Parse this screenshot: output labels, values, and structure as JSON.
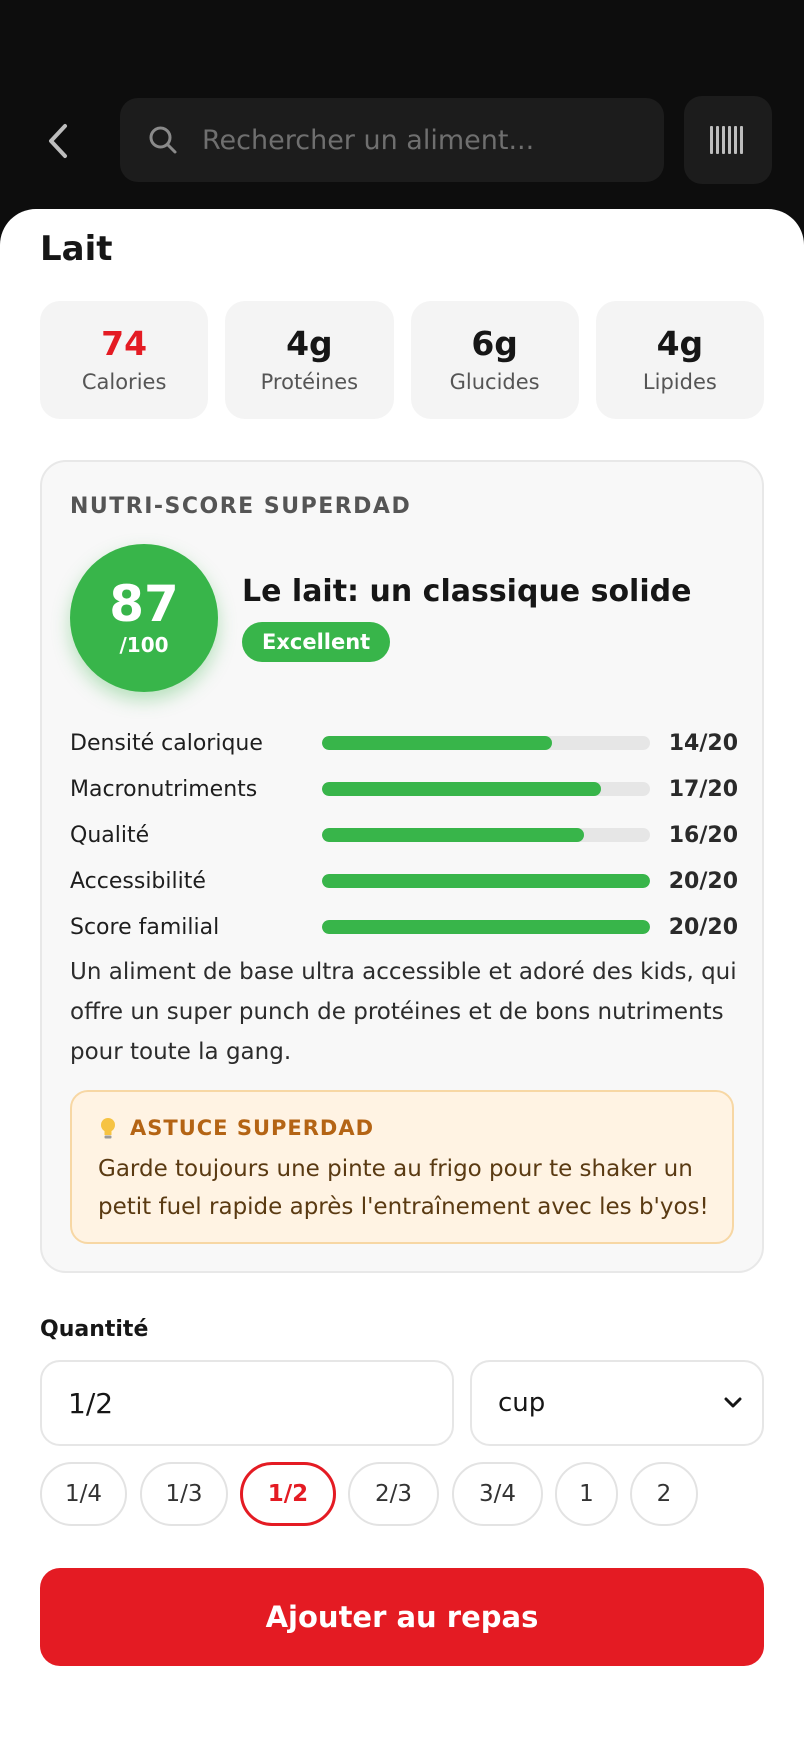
{
  "header": {
    "search_placeholder": "Rechercher un aliment..."
  },
  "food": {
    "name": "Lait"
  },
  "macros": [
    {
      "value": "74",
      "label": "Calories"
    },
    {
      "value": "4g",
      "label": "Protéines"
    },
    {
      "value": "6g",
      "label": "Glucides"
    },
    {
      "value": "4g",
      "label": "Lipides"
    }
  ],
  "score": {
    "heading": "NUTRI-SCORE SUPERDAD",
    "value": "87",
    "denominator": "/100",
    "title": "Le lait: un classique solide",
    "badge": "Excellent",
    "criteria": [
      {
        "name": "Densité calorique",
        "points": "14/20",
        "fraction": 0.7
      },
      {
        "name": "Macronutriments",
        "points": "17/20",
        "fraction": 0.85
      },
      {
        "name": "Qualité",
        "points": "16/20",
        "fraction": 0.8
      },
      {
        "name": "Accessibilité",
        "points": "20/20",
        "fraction": 1.0
      },
      {
        "name": "Score familial",
        "points": "20/20",
        "fraction": 1.0
      }
    ],
    "description": "Un aliment de base ultra accessible et adoré des kids, qui offre un super punch de protéines et de bons nutriments pour toute la gang.",
    "tip_heading": "ASTUCE SUPERDAD",
    "tip_body": "Garde toujours une pinte au frigo pour te shaker un petit fuel rapide après l'entraînement avec les b'yos!"
  },
  "quantity": {
    "label": "Quantité",
    "value": "1/2",
    "unit": "cup",
    "presets": [
      "1/4",
      "1/3",
      "1/2",
      "2/3",
      "3/4",
      "1",
      "2"
    ],
    "selected": "1/2"
  },
  "actions": {
    "add_label": "Ajouter au repas"
  },
  "colors": {
    "accent": "#e41b23",
    "score_green": "#38b54a",
    "tip_text": "#b46414"
  }
}
